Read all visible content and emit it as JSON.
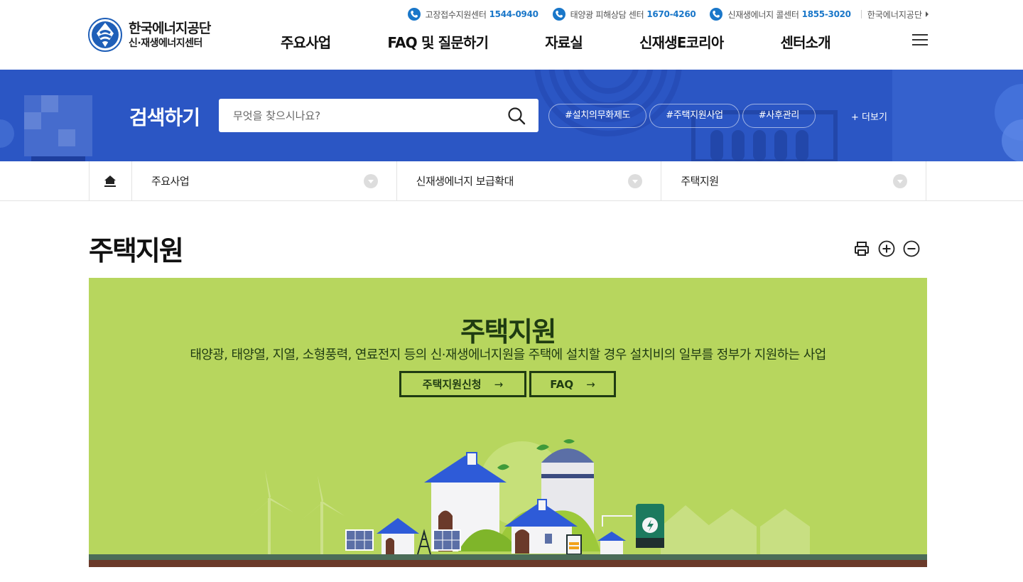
{
  "header": {
    "logo": {
      "name": "한국에너지공단",
      "sub": "신·재생에너지센터"
    },
    "util": [
      {
        "label": "고장접수지원센터",
        "number": "1544-0940"
      },
      {
        "label": "태양광 피해상담 센터",
        "number": "1670-4260"
      },
      {
        "label": "신재생에너지 콜센터",
        "number": "1855-3020"
      }
    ],
    "util_link": "한국에너지공단",
    "gnb": [
      "주요사업",
      "FAQ 및 질문하기",
      "자료실",
      "신재생E코리아",
      "센터소개"
    ]
  },
  "search": {
    "title": "검색하기",
    "placeholder": "무엇을 찾으시나요?",
    "tags": [
      "#설치의무화제도",
      "#주택지원사업",
      "#사후관리"
    ],
    "more": "+ 더보기"
  },
  "breadcrumb": [
    "주요사업",
    "신재생에너지 보급확대",
    "주택지원"
  ],
  "page": {
    "title": "주택지원"
  },
  "banner": {
    "title": "주택지원",
    "description": "태양광, 태양열, 지열, 소형풍력, 연료전지 등의 신·재생에너지원을 주택에 설치할 경우 설치비의 일부를 정부가 지원하는 사업",
    "buttons": [
      "주택지원신청",
      "FAQ"
    ],
    "arrow": "→"
  },
  "colors": {
    "brand_blue": "#2b56c4",
    "phone_blue": "#1a77c9",
    "banner_green": "#b7d65e",
    "banner_text": "#1f3b12"
  }
}
